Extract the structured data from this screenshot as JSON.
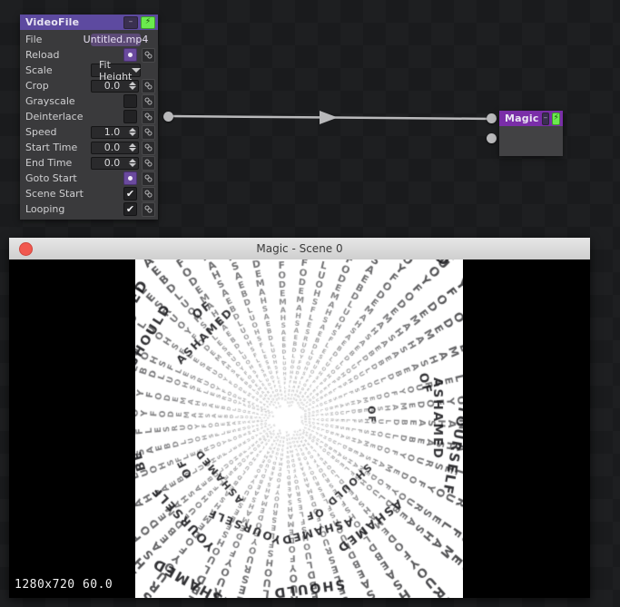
{
  "graph": {
    "nodes": [
      {
        "title": "VideoFile",
        "minimize_label": "–",
        "bolt_label": "⚡",
        "params": [
          {
            "label": "File",
            "type": "text",
            "value": "Untitled.mp4",
            "link": false
          },
          {
            "label": "Reload",
            "type": "radio",
            "value": "on",
            "link": true
          },
          {
            "label": "Scale",
            "type": "select",
            "value": "Fit Height",
            "link": false
          },
          {
            "label": "Crop",
            "type": "number",
            "value": "0.0",
            "link": true
          },
          {
            "label": "Grayscale",
            "type": "checkbox",
            "value": "off",
            "link": true
          },
          {
            "label": "Deinterlace",
            "type": "checkbox",
            "value": "off",
            "link": true
          },
          {
            "label": "Speed",
            "type": "number",
            "value": "1.0",
            "link": true
          },
          {
            "label": "Start Time",
            "type": "number",
            "value": "0.0",
            "link": true
          },
          {
            "label": "End Time",
            "type": "number",
            "value": "0.0",
            "link": true
          },
          {
            "label": "Goto Start",
            "type": "radio",
            "value": "on",
            "link": true
          },
          {
            "label": "Scene Start",
            "type": "checkbox",
            "value": "on",
            "link": true
          },
          {
            "label": "Looping",
            "type": "checkbox",
            "value": "on",
            "link": true
          }
        ]
      },
      {
        "title": "Magic",
        "minimize_label": "–",
        "bolt_label": "⚡",
        "params": []
      }
    ],
    "colors": {
      "videofile_header": "#5d4aa0",
      "magic_header": "#7a2ea8",
      "bolt_green": "#6bea4e",
      "field_purple": "#5c4a76",
      "wire": "#b9b9bb"
    }
  },
  "preview": {
    "window_title": "Magic - Scene 0",
    "close_label": "",
    "osd": "1280x720  60.0",
    "words": [
      "SHOULD",
      "BE",
      "ASHAMED",
      "OF",
      "YOURSELF"
    ]
  }
}
